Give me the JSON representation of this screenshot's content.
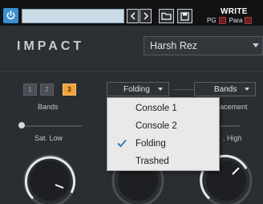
{
  "host": {
    "write_label": "WRITE",
    "pg_label": "PG",
    "para_label": "Para"
  },
  "plugin": {
    "name": "IMPACT",
    "preset": "Harsh Rez"
  },
  "bands": {
    "buttons": [
      "1",
      "2",
      "3"
    ],
    "selected": "3",
    "label": "Bands",
    "dropdown_value": "Bands"
  },
  "saturation": {
    "dropdown_value": "Folding",
    "options": [
      "Console 1",
      "Console 2",
      "Folding",
      "Trashed"
    ],
    "selected": "Folding"
  },
  "labels": {
    "sat_low": "Sat. Low",
    "sat_high_partial": ". High",
    "placement_partial": "lacement"
  },
  "knobs": {
    "sat_low_level": 0.75,
    "sat_high_level": 0.72
  }
}
